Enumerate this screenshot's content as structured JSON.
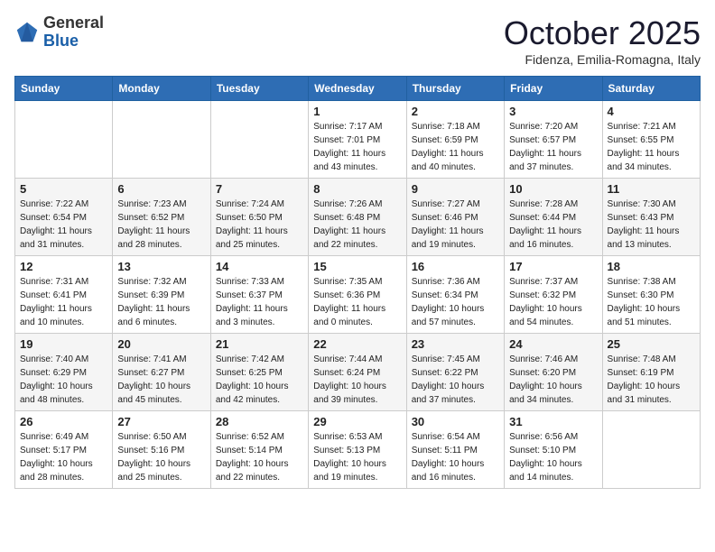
{
  "header": {
    "logo": {
      "line1": "General",
      "line2": "Blue"
    },
    "title": "October 2025",
    "location": "Fidenza, Emilia-Romagna, Italy"
  },
  "weekdays": [
    "Sunday",
    "Monday",
    "Tuesday",
    "Wednesday",
    "Thursday",
    "Friday",
    "Saturday"
  ],
  "weeks": [
    [
      {
        "day": "",
        "sunrise": "",
        "sunset": "",
        "daylight": ""
      },
      {
        "day": "",
        "sunrise": "",
        "sunset": "",
        "daylight": ""
      },
      {
        "day": "",
        "sunrise": "",
        "sunset": "",
        "daylight": ""
      },
      {
        "day": "1",
        "sunrise": "Sunrise: 7:17 AM",
        "sunset": "Sunset: 7:01 PM",
        "daylight": "Daylight: 11 hours and 43 minutes."
      },
      {
        "day": "2",
        "sunrise": "Sunrise: 7:18 AM",
        "sunset": "Sunset: 6:59 PM",
        "daylight": "Daylight: 11 hours and 40 minutes."
      },
      {
        "day": "3",
        "sunrise": "Sunrise: 7:20 AM",
        "sunset": "Sunset: 6:57 PM",
        "daylight": "Daylight: 11 hours and 37 minutes."
      },
      {
        "day": "4",
        "sunrise": "Sunrise: 7:21 AM",
        "sunset": "Sunset: 6:55 PM",
        "daylight": "Daylight: 11 hours and 34 minutes."
      }
    ],
    [
      {
        "day": "5",
        "sunrise": "Sunrise: 7:22 AM",
        "sunset": "Sunset: 6:54 PM",
        "daylight": "Daylight: 11 hours and 31 minutes."
      },
      {
        "day": "6",
        "sunrise": "Sunrise: 7:23 AM",
        "sunset": "Sunset: 6:52 PM",
        "daylight": "Daylight: 11 hours and 28 minutes."
      },
      {
        "day": "7",
        "sunrise": "Sunrise: 7:24 AM",
        "sunset": "Sunset: 6:50 PM",
        "daylight": "Daylight: 11 hours and 25 minutes."
      },
      {
        "day": "8",
        "sunrise": "Sunrise: 7:26 AM",
        "sunset": "Sunset: 6:48 PM",
        "daylight": "Daylight: 11 hours and 22 minutes."
      },
      {
        "day": "9",
        "sunrise": "Sunrise: 7:27 AM",
        "sunset": "Sunset: 6:46 PM",
        "daylight": "Daylight: 11 hours and 19 minutes."
      },
      {
        "day": "10",
        "sunrise": "Sunrise: 7:28 AM",
        "sunset": "Sunset: 6:44 PM",
        "daylight": "Daylight: 11 hours and 16 minutes."
      },
      {
        "day": "11",
        "sunrise": "Sunrise: 7:30 AM",
        "sunset": "Sunset: 6:43 PM",
        "daylight": "Daylight: 11 hours and 13 minutes."
      }
    ],
    [
      {
        "day": "12",
        "sunrise": "Sunrise: 7:31 AM",
        "sunset": "Sunset: 6:41 PM",
        "daylight": "Daylight: 11 hours and 10 minutes."
      },
      {
        "day": "13",
        "sunrise": "Sunrise: 7:32 AM",
        "sunset": "Sunset: 6:39 PM",
        "daylight": "Daylight: 11 hours and 6 minutes."
      },
      {
        "day": "14",
        "sunrise": "Sunrise: 7:33 AM",
        "sunset": "Sunset: 6:37 PM",
        "daylight": "Daylight: 11 hours and 3 minutes."
      },
      {
        "day": "15",
        "sunrise": "Sunrise: 7:35 AM",
        "sunset": "Sunset: 6:36 PM",
        "daylight": "Daylight: 11 hours and 0 minutes."
      },
      {
        "day": "16",
        "sunrise": "Sunrise: 7:36 AM",
        "sunset": "Sunset: 6:34 PM",
        "daylight": "Daylight: 10 hours and 57 minutes."
      },
      {
        "day": "17",
        "sunrise": "Sunrise: 7:37 AM",
        "sunset": "Sunset: 6:32 PM",
        "daylight": "Daylight: 10 hours and 54 minutes."
      },
      {
        "day": "18",
        "sunrise": "Sunrise: 7:38 AM",
        "sunset": "Sunset: 6:30 PM",
        "daylight": "Daylight: 10 hours and 51 minutes."
      }
    ],
    [
      {
        "day": "19",
        "sunrise": "Sunrise: 7:40 AM",
        "sunset": "Sunset: 6:29 PM",
        "daylight": "Daylight: 10 hours and 48 minutes."
      },
      {
        "day": "20",
        "sunrise": "Sunrise: 7:41 AM",
        "sunset": "Sunset: 6:27 PM",
        "daylight": "Daylight: 10 hours and 45 minutes."
      },
      {
        "day": "21",
        "sunrise": "Sunrise: 7:42 AM",
        "sunset": "Sunset: 6:25 PM",
        "daylight": "Daylight: 10 hours and 42 minutes."
      },
      {
        "day": "22",
        "sunrise": "Sunrise: 7:44 AM",
        "sunset": "Sunset: 6:24 PM",
        "daylight": "Daylight: 10 hours and 39 minutes."
      },
      {
        "day": "23",
        "sunrise": "Sunrise: 7:45 AM",
        "sunset": "Sunset: 6:22 PM",
        "daylight": "Daylight: 10 hours and 37 minutes."
      },
      {
        "day": "24",
        "sunrise": "Sunrise: 7:46 AM",
        "sunset": "Sunset: 6:20 PM",
        "daylight": "Daylight: 10 hours and 34 minutes."
      },
      {
        "day": "25",
        "sunrise": "Sunrise: 7:48 AM",
        "sunset": "Sunset: 6:19 PM",
        "daylight": "Daylight: 10 hours and 31 minutes."
      }
    ],
    [
      {
        "day": "26",
        "sunrise": "Sunrise: 6:49 AM",
        "sunset": "Sunset: 5:17 PM",
        "daylight": "Daylight: 10 hours and 28 minutes."
      },
      {
        "day": "27",
        "sunrise": "Sunrise: 6:50 AM",
        "sunset": "Sunset: 5:16 PM",
        "daylight": "Daylight: 10 hours and 25 minutes."
      },
      {
        "day": "28",
        "sunrise": "Sunrise: 6:52 AM",
        "sunset": "Sunset: 5:14 PM",
        "daylight": "Daylight: 10 hours and 22 minutes."
      },
      {
        "day": "29",
        "sunrise": "Sunrise: 6:53 AM",
        "sunset": "Sunset: 5:13 PM",
        "daylight": "Daylight: 10 hours and 19 minutes."
      },
      {
        "day": "30",
        "sunrise": "Sunrise: 6:54 AM",
        "sunset": "Sunset: 5:11 PM",
        "daylight": "Daylight: 10 hours and 16 minutes."
      },
      {
        "day": "31",
        "sunrise": "Sunrise: 6:56 AM",
        "sunset": "Sunset: 5:10 PM",
        "daylight": "Daylight: 10 hours and 14 minutes."
      },
      {
        "day": "",
        "sunrise": "",
        "sunset": "",
        "daylight": ""
      }
    ]
  ]
}
